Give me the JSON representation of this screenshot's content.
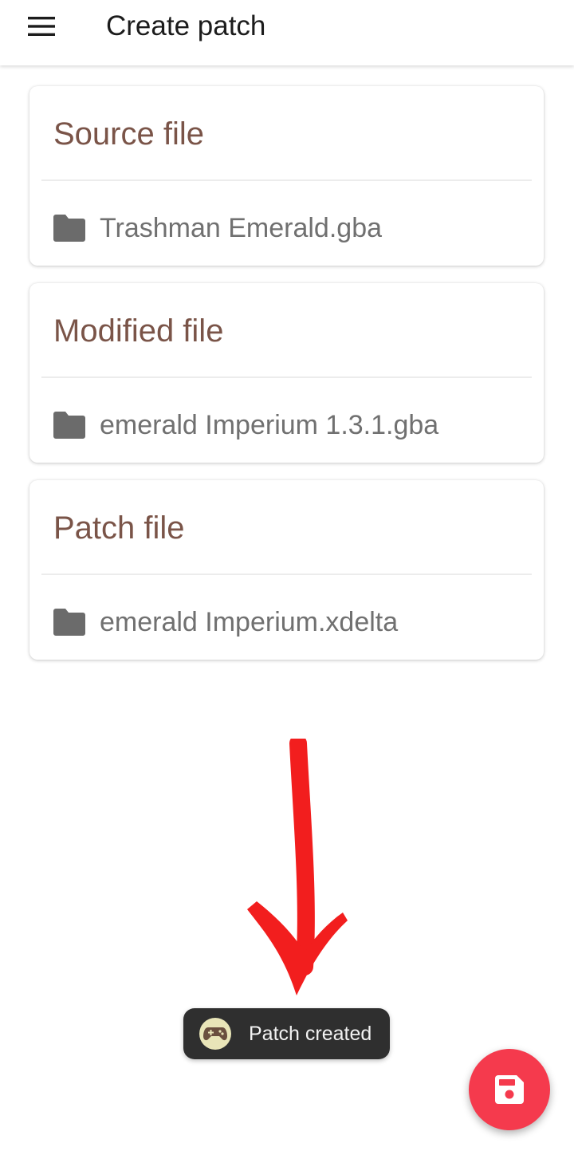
{
  "toolbar": {
    "title": "Create patch",
    "menu_icon": "hamburger-menu-icon"
  },
  "cards": [
    {
      "title": "Source file",
      "file": "Trashman Emerald.gba",
      "icon": "folder-icon"
    },
    {
      "title": "Modified file",
      "file": "emerald Imperium 1.3.1.gba",
      "icon": "folder-icon"
    },
    {
      "title": "Patch file",
      "file": "emerald Imperium.xdelta",
      "icon": "folder-icon"
    }
  ],
  "toast": {
    "text": "Patch created",
    "icon": "gamepad-icon"
  },
  "fab": {
    "icon": "save-icon"
  },
  "annotation": {
    "icon": "red-arrow-icon"
  },
  "colors": {
    "card_title": "#7a5448",
    "file_text": "#707070",
    "fab": "#f53a4d",
    "toast_bg": "#2f2f2f",
    "arrow": "#f21e1e"
  }
}
